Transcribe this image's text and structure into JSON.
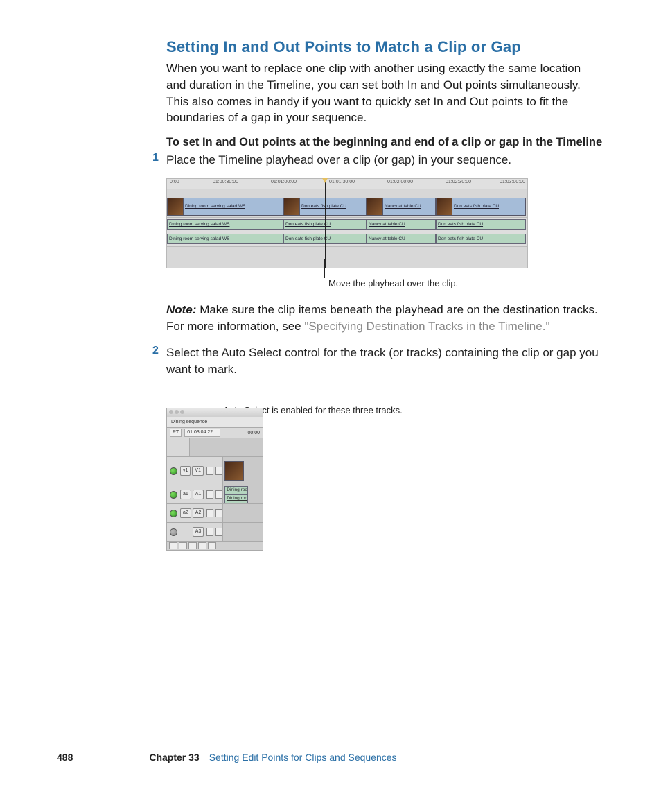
{
  "heading": "Setting In and Out Points to Match a Clip or Gap",
  "intro": "When you want to replace one clip with another using exactly the same location and duration in the Timeline, you can set both In and Out points simultaneously. This also comes in handy if you want to quickly set In and Out points to fit the boundaries of a gap in your sequence.",
  "procedure_title": "To set In and Out points at the beginning and end of a clip or gap in the Timeline",
  "steps": {
    "1": "Place the Timeline playhead over a clip (or gap) in your sequence.",
    "2": "Select the Auto Select control for the track (or tracks) containing the clip or gap you want to mark."
  },
  "figure1": {
    "ruler": [
      "0:00",
      "01:00:30:00",
      "01:01:00:00",
      "01:01:30:00",
      "01:02:00:00",
      "01:02:30:00",
      "01:03:00:00"
    ],
    "clips": {
      "c1": "Dining room serving salad WS",
      "c2": "Don eats fish plate CU",
      "c3": "Nancy at table CU",
      "c4": "Don eats fish plate CU"
    },
    "callout": "Move the playhead over the clip."
  },
  "note": {
    "label": "Note:",
    "body_a": "Make sure the clip items beneath the playhead are on the destination tracks. For more information, see ",
    "link": "\"Specifying Destination Tracks in the Timeline.\""
  },
  "figure2": {
    "callout": "Auto Select is enabled for these three tracks.",
    "tab": "Dining sequence",
    "rt": "RT",
    "tc": "01:03:04:22",
    "tc2": "00:00",
    "tracks": {
      "v1a": "v1",
      "v1b": "V1",
      "a1a": "a1",
      "a1b": "A1",
      "a2a": "a2",
      "a2b": "A2",
      "a3": "A3"
    },
    "cliplabel": "Dining roo"
  },
  "footer": {
    "page": "488",
    "chapter": "Chapter 33",
    "title": "Setting Edit Points for Clips and Sequences"
  }
}
